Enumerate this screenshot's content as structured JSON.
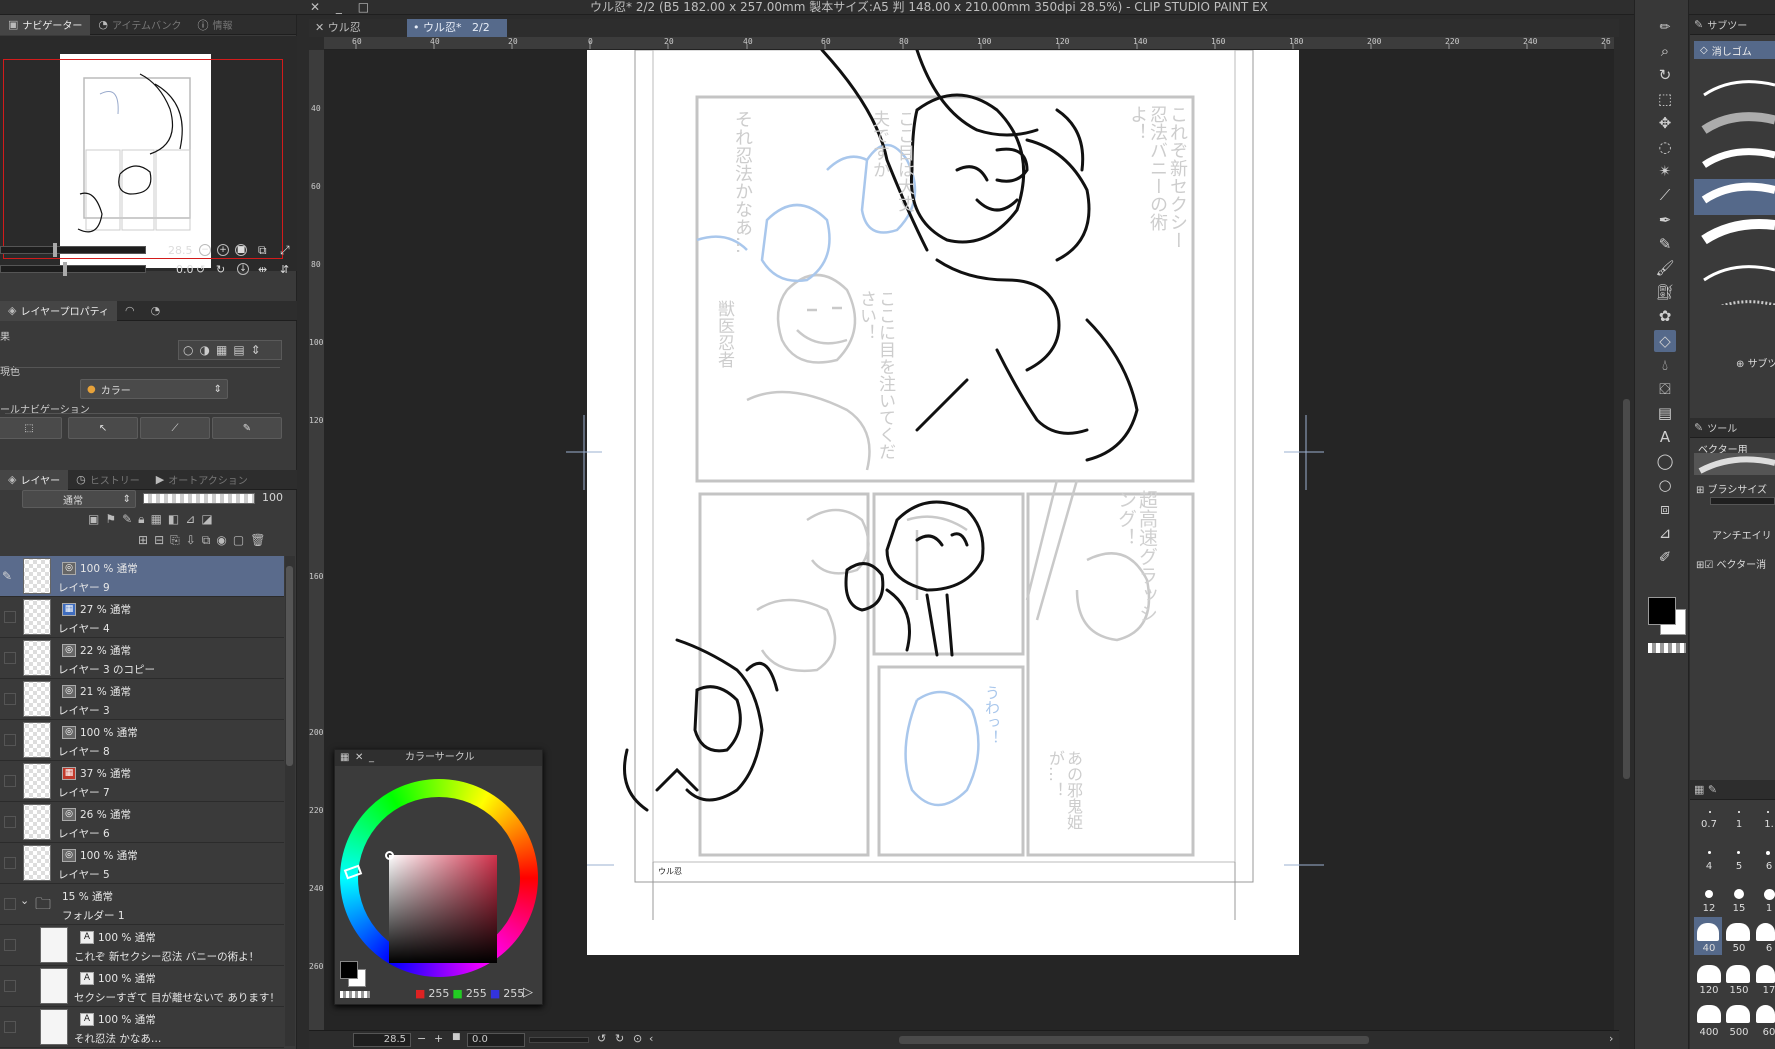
{
  "window": {
    "title": "ウル忍* 2/2 (B5 182.00 x 257.00mm 製本サイズ:A5 判 148.00 x 210.00mm 350dpi 28.5%) - CLIP STUDIO PAINT EX"
  },
  "navigator_panel": {
    "tabs": [
      "ナビゲーター",
      "アイテムバンク",
      "情報"
    ],
    "zoom_value": "28.5",
    "rotate_value": "0.0"
  },
  "layer_property_panel": {
    "tabs": [
      "レイヤープロパティ"
    ],
    "effect_label": "果",
    "expression_color_label": "現色",
    "expression_color_value": "カラー",
    "tool_nav_label": "ールナビゲーション"
  },
  "layer_panel": {
    "tabs": [
      "レイヤー",
      "ヒストリー",
      "オートアクション"
    ],
    "blend_mode": "通常",
    "opacity": "100",
    "layers": [
      {
        "mode": "100 % 通常",
        "name": "レイヤー 9",
        "selected": true,
        "type": "raster"
      },
      {
        "mode": "27 % 通常",
        "name": "レイヤー 4",
        "selected": false,
        "type": "color"
      },
      {
        "mode": "22 % 通常",
        "name": "レイヤー 3 のコピー",
        "selected": false,
        "type": "raster"
      },
      {
        "mode": "21 % 通常",
        "name": "レイヤー 3",
        "selected": false,
        "type": "raster"
      },
      {
        "mode": "100 % 通常",
        "name": "レイヤー 8",
        "selected": false,
        "type": "raster"
      },
      {
        "mode": "37 % 通常",
        "name": "レイヤー 7",
        "selected": false,
        "type": "color"
      },
      {
        "mode": "26 % 通常",
        "name": "レイヤー 6",
        "selected": false,
        "type": "raster"
      },
      {
        "mode": "100 % 通常",
        "name": "レイヤー 5",
        "selected": false,
        "type": "raster"
      },
      {
        "mode": "15 % 通常",
        "name": "フォルダー 1",
        "selected": false,
        "type": "folder"
      },
      {
        "mode": "100 % 通常",
        "name": "これぞ 新セクシー忍法 バニーの術よ！",
        "selected": false,
        "type": "text"
      },
      {
        "mode": "100 % 通常",
        "name": "セクシーすぎて 目が離せないで あります！",
        "selected": false,
        "type": "text"
      },
      {
        "mode": "100 % 通常",
        "name": "それ忍法 かなあ…",
        "selected": false,
        "type": "text"
      }
    ]
  },
  "document_tabs": [
    {
      "label": "ウル忍",
      "active": false
    },
    {
      "label": "ウル忍*",
      "page": "2/2",
      "active": true
    }
  ],
  "ruler": {
    "top_ticks": [
      "60",
      "40",
      "20",
      "0",
      "20",
      "40",
      "60",
      "80",
      "100",
      "120",
      "140",
      "160",
      "180",
      "200",
      "220",
      "240",
      "26"
    ],
    "left_ticks": [
      "40",
      "60",
      "80",
      "100",
      "120",
      "160",
      "200",
      "220",
      "240",
      "260"
    ]
  },
  "canvas": {
    "page_label": "ウル忍",
    "manga_text": {
      "p1": "これぞ新セクシー忍法バニーの術よ！",
      "p2": "それ忍法かなあ…",
      "p3": "ここ目は大丈夫ですか",
      "p4": "獣医忍者",
      "p5": "ここに目を注いてください！",
      "p6": "超高速グラッシング！",
      "p7": "うわっ！",
      "p8": "あの邪鬼姫が…！"
    }
  },
  "color_circle": {
    "title": "カラーサークル",
    "r": "255",
    "g": "255",
    "b": "255",
    "main_color": "#000000",
    "sub_color": "#ffffff"
  },
  "bottom_bar": {
    "zoom": "28.5",
    "rotate": "0.0"
  },
  "right_panel": {
    "subtool_title": "サブツー",
    "selected_subtool": "消しゴム",
    "add_subtool": "サブツ",
    "tool_property_title": "ツール",
    "vector_label": "ベクター用",
    "brush_size_label": "ブラシサイズ",
    "antialias_label": "アンチエイリ",
    "vector_erase_label": "ベクター消",
    "brush_sizes": [
      "0.7",
      "1",
      "1.",
      "4",
      "5",
      "6",
      "12",
      "15",
      "1",
      "40",
      "50",
      "6",
      "120",
      "150",
      "17",
      "400",
      "500",
      "60"
    ]
  }
}
